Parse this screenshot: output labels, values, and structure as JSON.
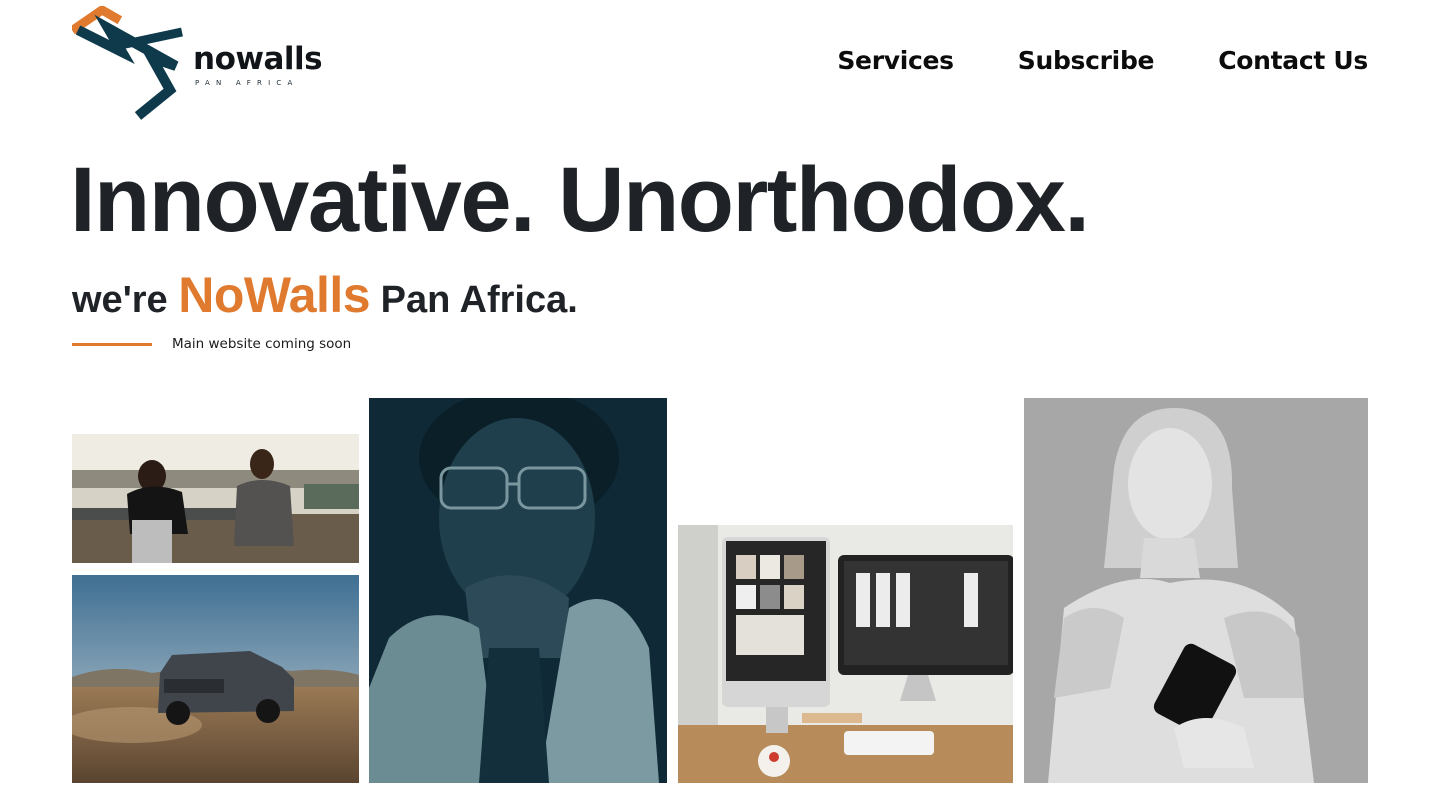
{
  "brand": {
    "wordmark": "nowalls",
    "subtitle": "PAN AFRICA",
    "accent_color": "#e07a2f",
    "dark_color": "#0e3a4c"
  },
  "nav": {
    "items": [
      {
        "label": "Services"
      },
      {
        "label": "Subscribe"
      },
      {
        "label": "Contact Us"
      }
    ]
  },
  "hero": {
    "headline": "Innovative. Unorthodox.",
    "intro_prefix": "we're",
    "intro_brand": "NoWalls",
    "intro_suffix": "Pan Africa.",
    "tagline": "Main website coming soon"
  },
  "gallery": {
    "images": [
      {
        "icon": "office-meeting-photo"
      },
      {
        "icon": "suv-desert-photo"
      },
      {
        "icon": "woman-portrait-photo"
      },
      {
        "icon": "design-workstation-photo"
      },
      {
        "icon": "statue-with-phone-photo"
      }
    ]
  }
}
